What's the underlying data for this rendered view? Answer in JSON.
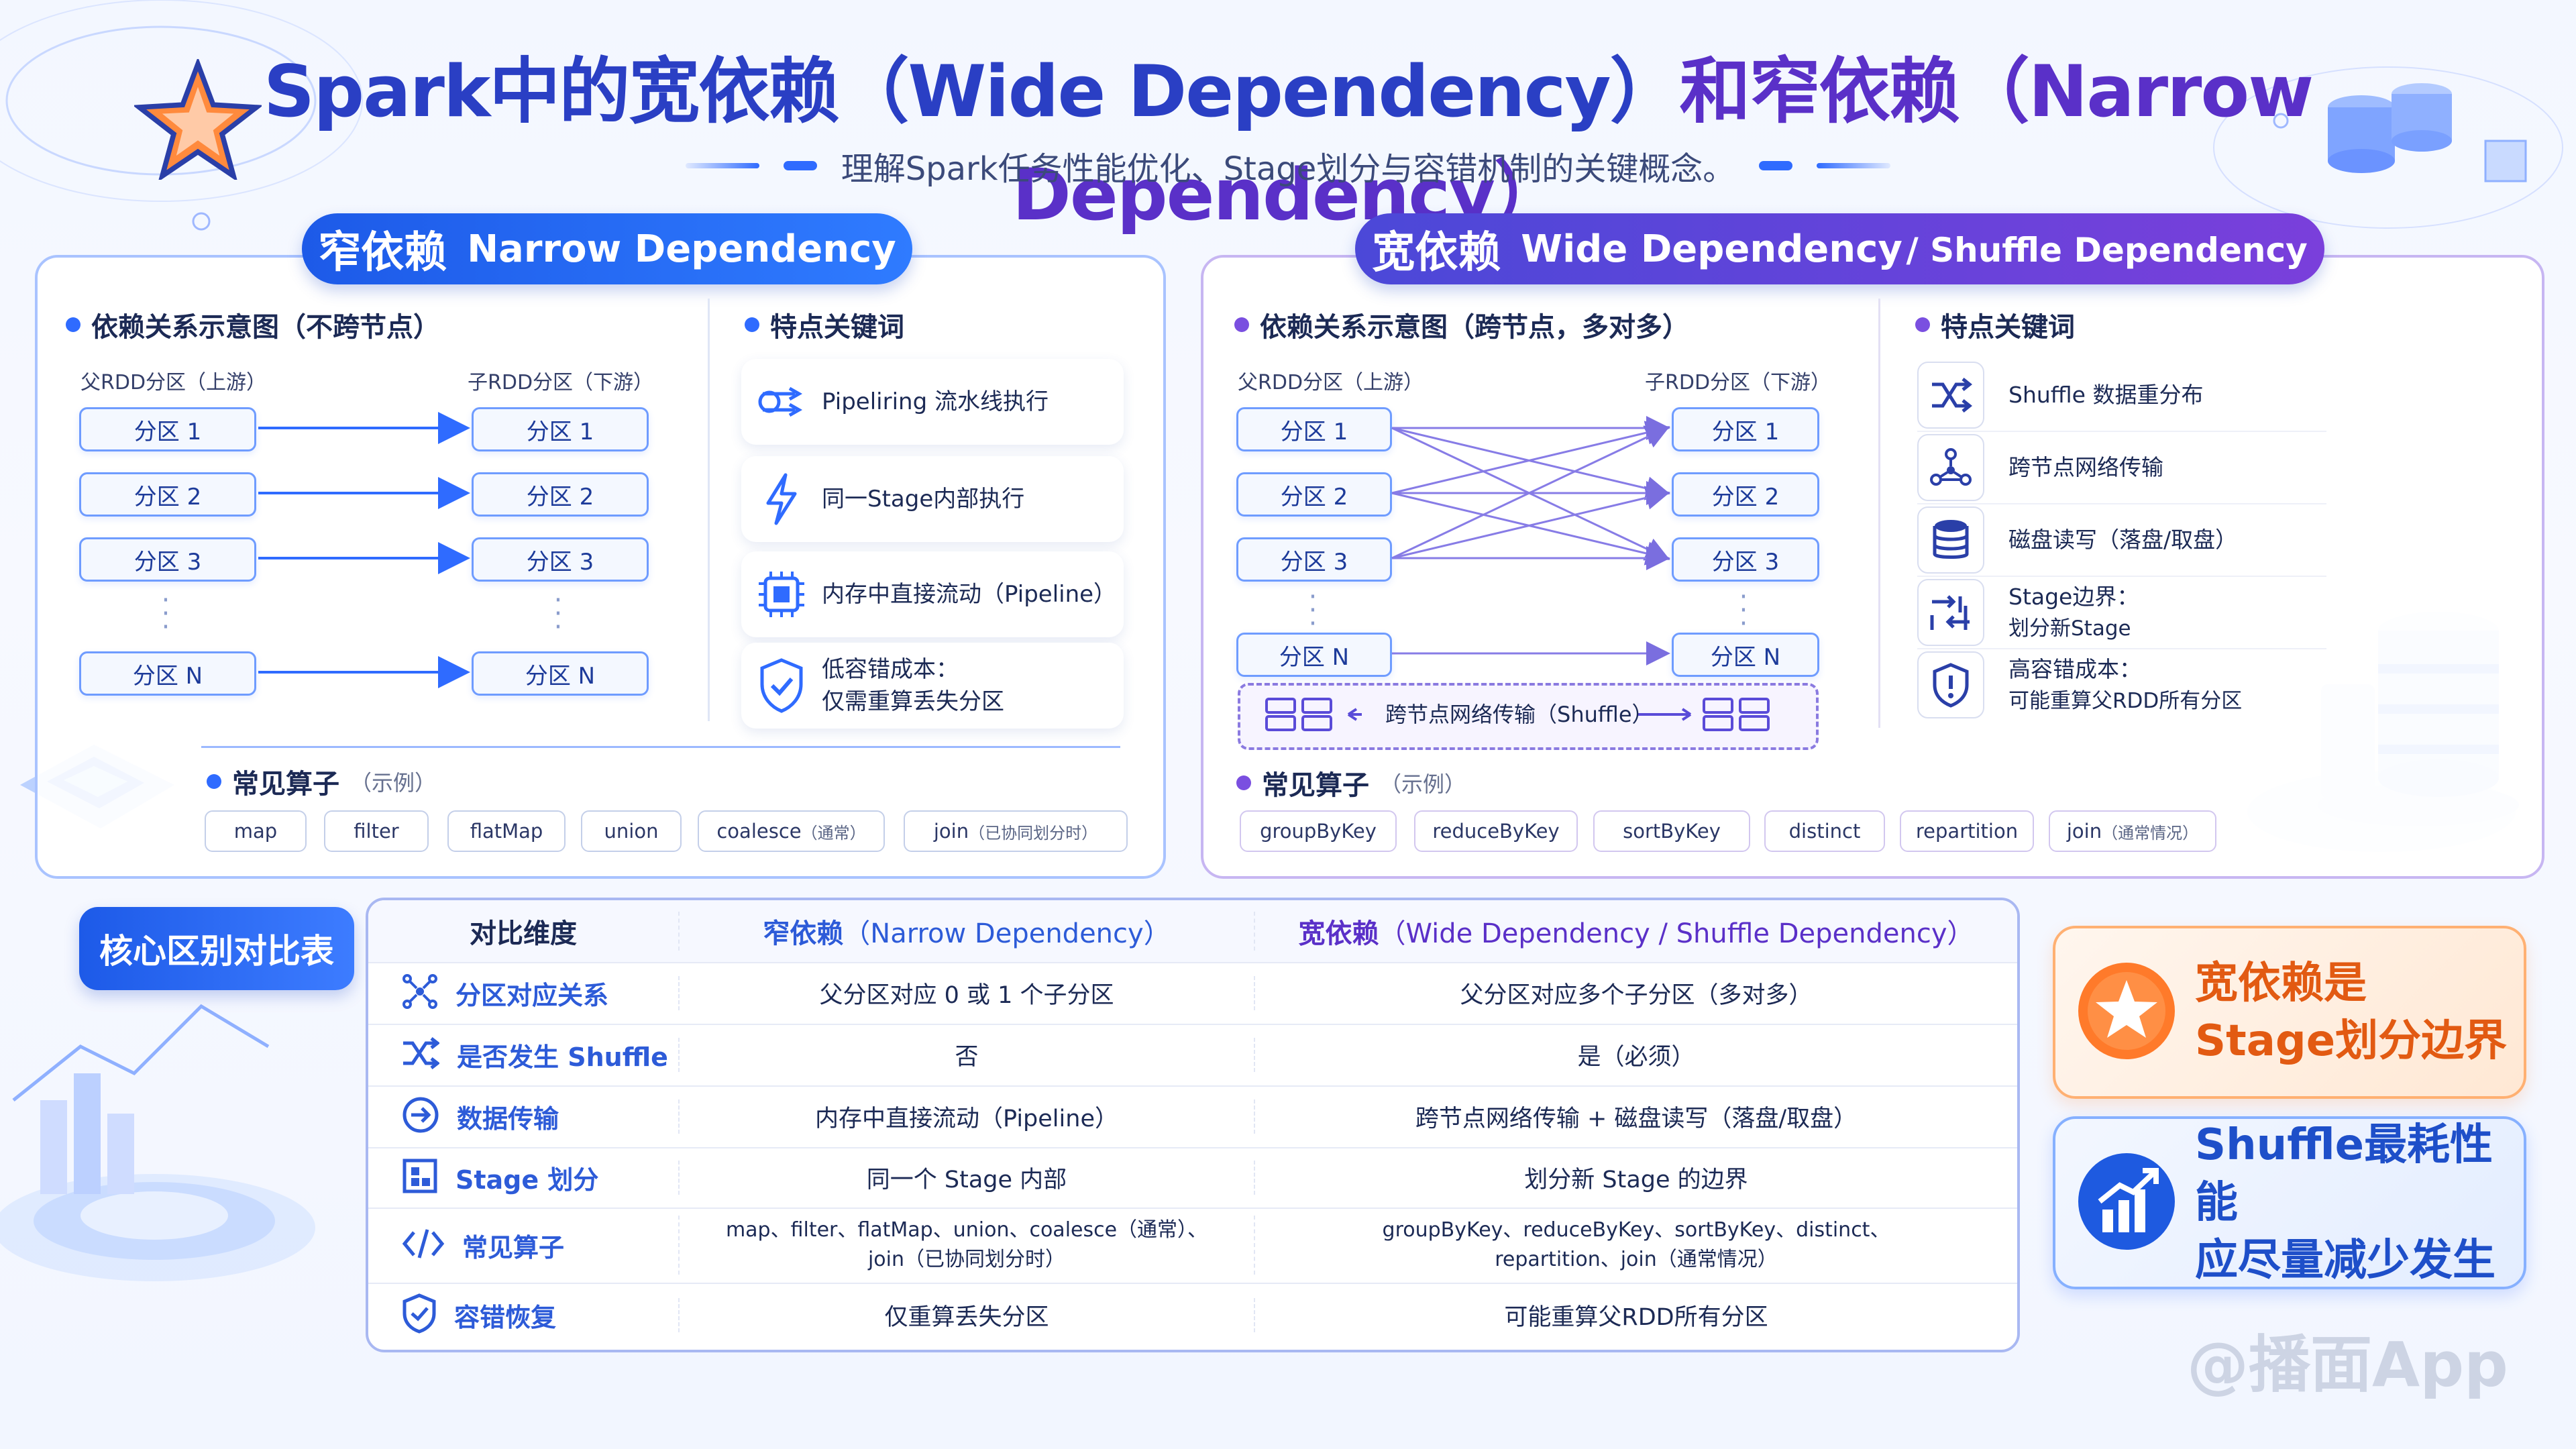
{
  "header": {
    "title_part1": "Spark中的宽依赖（Wide Dependency）",
    "title_part2": "和窄依赖（Narrow Dependency）",
    "subtitle": "理解Spark任务性能优化、Stage划分与容错机制的关键概念。"
  },
  "narrow": {
    "banner_cn": "窄依赖",
    "banner_en": "Narrow Dependency",
    "diagram_title": "依赖关系示意图（不跨节点）",
    "parent_head": "父RDD分区（上游）",
    "child_head": "子RDD分区（下游）",
    "parents": [
      "分区 1",
      "分区 2",
      "分区 3",
      "分区 N"
    ],
    "children": [
      "分区 1",
      "分区 2",
      "分区 3",
      "分区 N"
    ],
    "features_title": "特点关键词",
    "features": [
      "Pipeliring 流水线执行",
      "同一Stage内部执行",
      "内存中直接流动（Pipeline）",
      "低容错成本：",
      "仅需重算丢失分区"
    ],
    "ops_title": "常见算子",
    "ops_note": "（示例）",
    "ops": [
      "map",
      "filter",
      "flatMap",
      "union",
      "coalesce",
      "（通常）",
      "join",
      "（已协同划分时）"
    ]
  },
  "wide": {
    "banner_cn": "宽依赖",
    "banner_en": "Wide Dependency",
    "banner_en2": "/ Shuffle Dependency",
    "diagram_title": "依赖关系示意图（跨节点，多对多）",
    "parent_head": "父RDD分区（上游）",
    "child_head": "子RDD分区（下游）",
    "parents": [
      "分区 1",
      "分区 2",
      "分区 3",
      "分区 N"
    ],
    "children": [
      "分区 1",
      "分区 2",
      "分区 3",
      "分区 N"
    ],
    "shuffle_label": "跨节点网络传输（Shuffle）",
    "features_title": "特点关键词",
    "features": [
      "Shuffle 数据重分布",
      "跨节点网络传输",
      "磁盘读写（落盘/取盘）",
      "Stage边界：",
      "划分新Stage",
      "高容错成本：",
      "可能重算父RDD所有分区"
    ],
    "ops_title": "常见算子",
    "ops_note": "（示例）",
    "ops": [
      "groupByKey",
      "reduceByKey",
      "sortByKey",
      "distinct",
      "repartition",
      "join",
      "（通常情况）"
    ]
  },
  "table": {
    "tag": "核心区别对比表",
    "head": [
      "对比维度",
      "窄依赖",
      "（Narrow Dependency）",
      "宽依赖",
      "（Wide Dependency / Shuffle Dependency）"
    ],
    "rows": [
      {
        "dim": "分区对应关系",
        "narrow": "父分区对应 0 或 1 个子分区",
        "wide": "父分区对应多个子分区（多对多）"
      },
      {
        "dim": "是否发生 Shuffle",
        "narrow": "否",
        "wide": "是（必须）"
      },
      {
        "dim": "数据传输",
        "narrow": "内存中直接流动（Pipeline）",
        "wide": "跨节点网络传输 + 磁盘读写（落盘/取盘）"
      },
      {
        "dim": "Stage 划分",
        "narrow": "同一个 Stage 内部",
        "wide": "划分新 Stage 的边界"
      },
      {
        "dim": "常见算子",
        "narrow": "map、filter、flatMap、union、coalesce（通常）、",
        "narrow2": "join（已协同划分时）",
        "wide": "groupByKey、reduceByKey、sortByKey、distinct、",
        "wide2": "repartition、join（通常情况）"
      },
      {
        "dim": "容错恢复",
        "narrow": "仅重算丢失分区",
        "wide": "可能重算父RDD所有分区"
      }
    ]
  },
  "callouts": {
    "orange_line1": "宽依赖是",
    "orange_line2": "Stage划分边界",
    "blue_line1": "Shuffle最耗性能",
    "blue_line2": "应尽量减少发生"
  },
  "watermark": "@播面App",
  "colors": {
    "primary": "#2f6bff",
    "purple": "#7a4fe0",
    "orange": "#ff7a2a"
  },
  "icons": [
    "star-icon",
    "database-icon",
    "pipeline-icon",
    "lightning-icon",
    "chip-icon",
    "shield-check-icon",
    "shuffle-icon",
    "network-icon",
    "disk-icon",
    "sort-icon",
    "shield-alert-icon",
    "server-icon",
    "share-icon",
    "arrow-circle-icon",
    "grid-icon",
    "code-icon",
    "chart-up-icon"
  ]
}
